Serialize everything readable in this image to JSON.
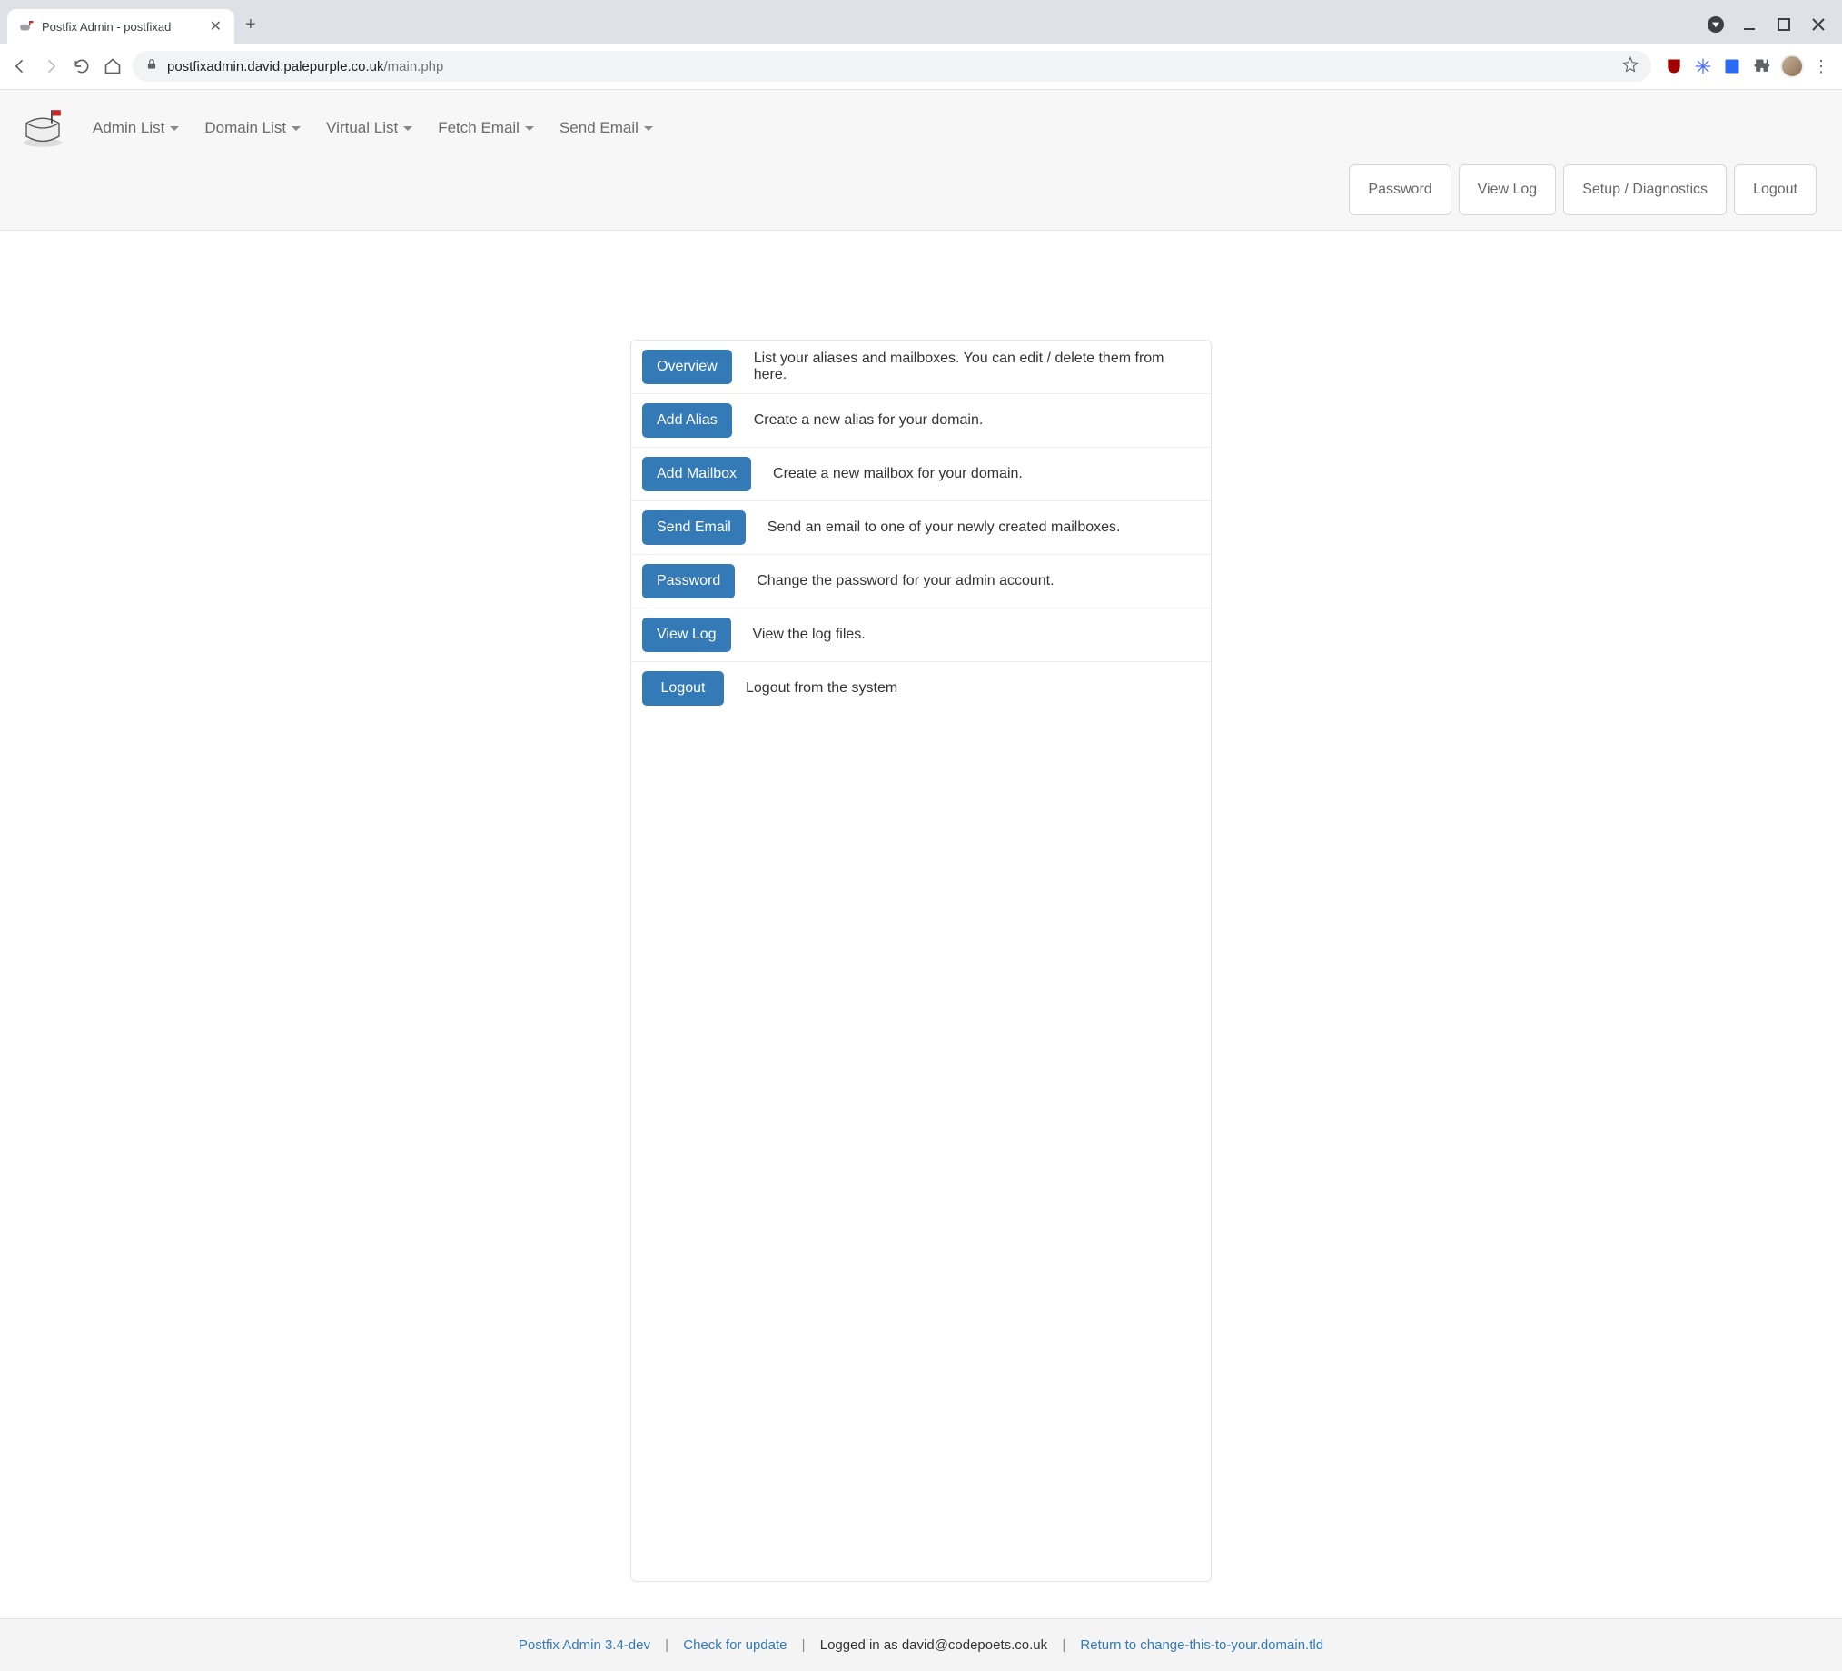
{
  "browser": {
    "tab_title": "Postfix Admin - postfixad",
    "url_host": "postfixadmin.david.palepurple.co.uk",
    "url_path": "/main.php"
  },
  "nav": {
    "items": [
      {
        "label": "Admin List"
      },
      {
        "label": "Domain List"
      },
      {
        "label": "Virtual List"
      },
      {
        "label": "Fetch Email"
      },
      {
        "label": "Send Email"
      }
    ],
    "secondary": [
      {
        "label": "Password"
      },
      {
        "label": "View Log"
      },
      {
        "label": "Setup / Diagnostics"
      },
      {
        "label": "Logout"
      }
    ]
  },
  "main": {
    "rows": [
      {
        "button": "Overview",
        "desc": "List your aliases and mailboxes. You can edit / delete them from here."
      },
      {
        "button": "Add Alias",
        "desc": "Create a new alias for your domain."
      },
      {
        "button": "Add Mailbox",
        "desc": "Create a new mailbox for your domain."
      },
      {
        "button": "Send Email",
        "desc": "Send an email to one of your newly created mailboxes."
      },
      {
        "button": "Password",
        "desc": "Change the password for your admin account."
      },
      {
        "button": "View Log",
        "desc": "View the log files."
      },
      {
        "button": "Logout",
        "desc": "Logout from the system"
      }
    ]
  },
  "footer": {
    "version_link": "Postfix Admin 3.4-dev",
    "check_update": "Check for update",
    "logged_in": "Logged in as david@codepoets.co.uk",
    "return_link": "Return to change-this-to-your.domain.tld",
    "sep": "|"
  }
}
